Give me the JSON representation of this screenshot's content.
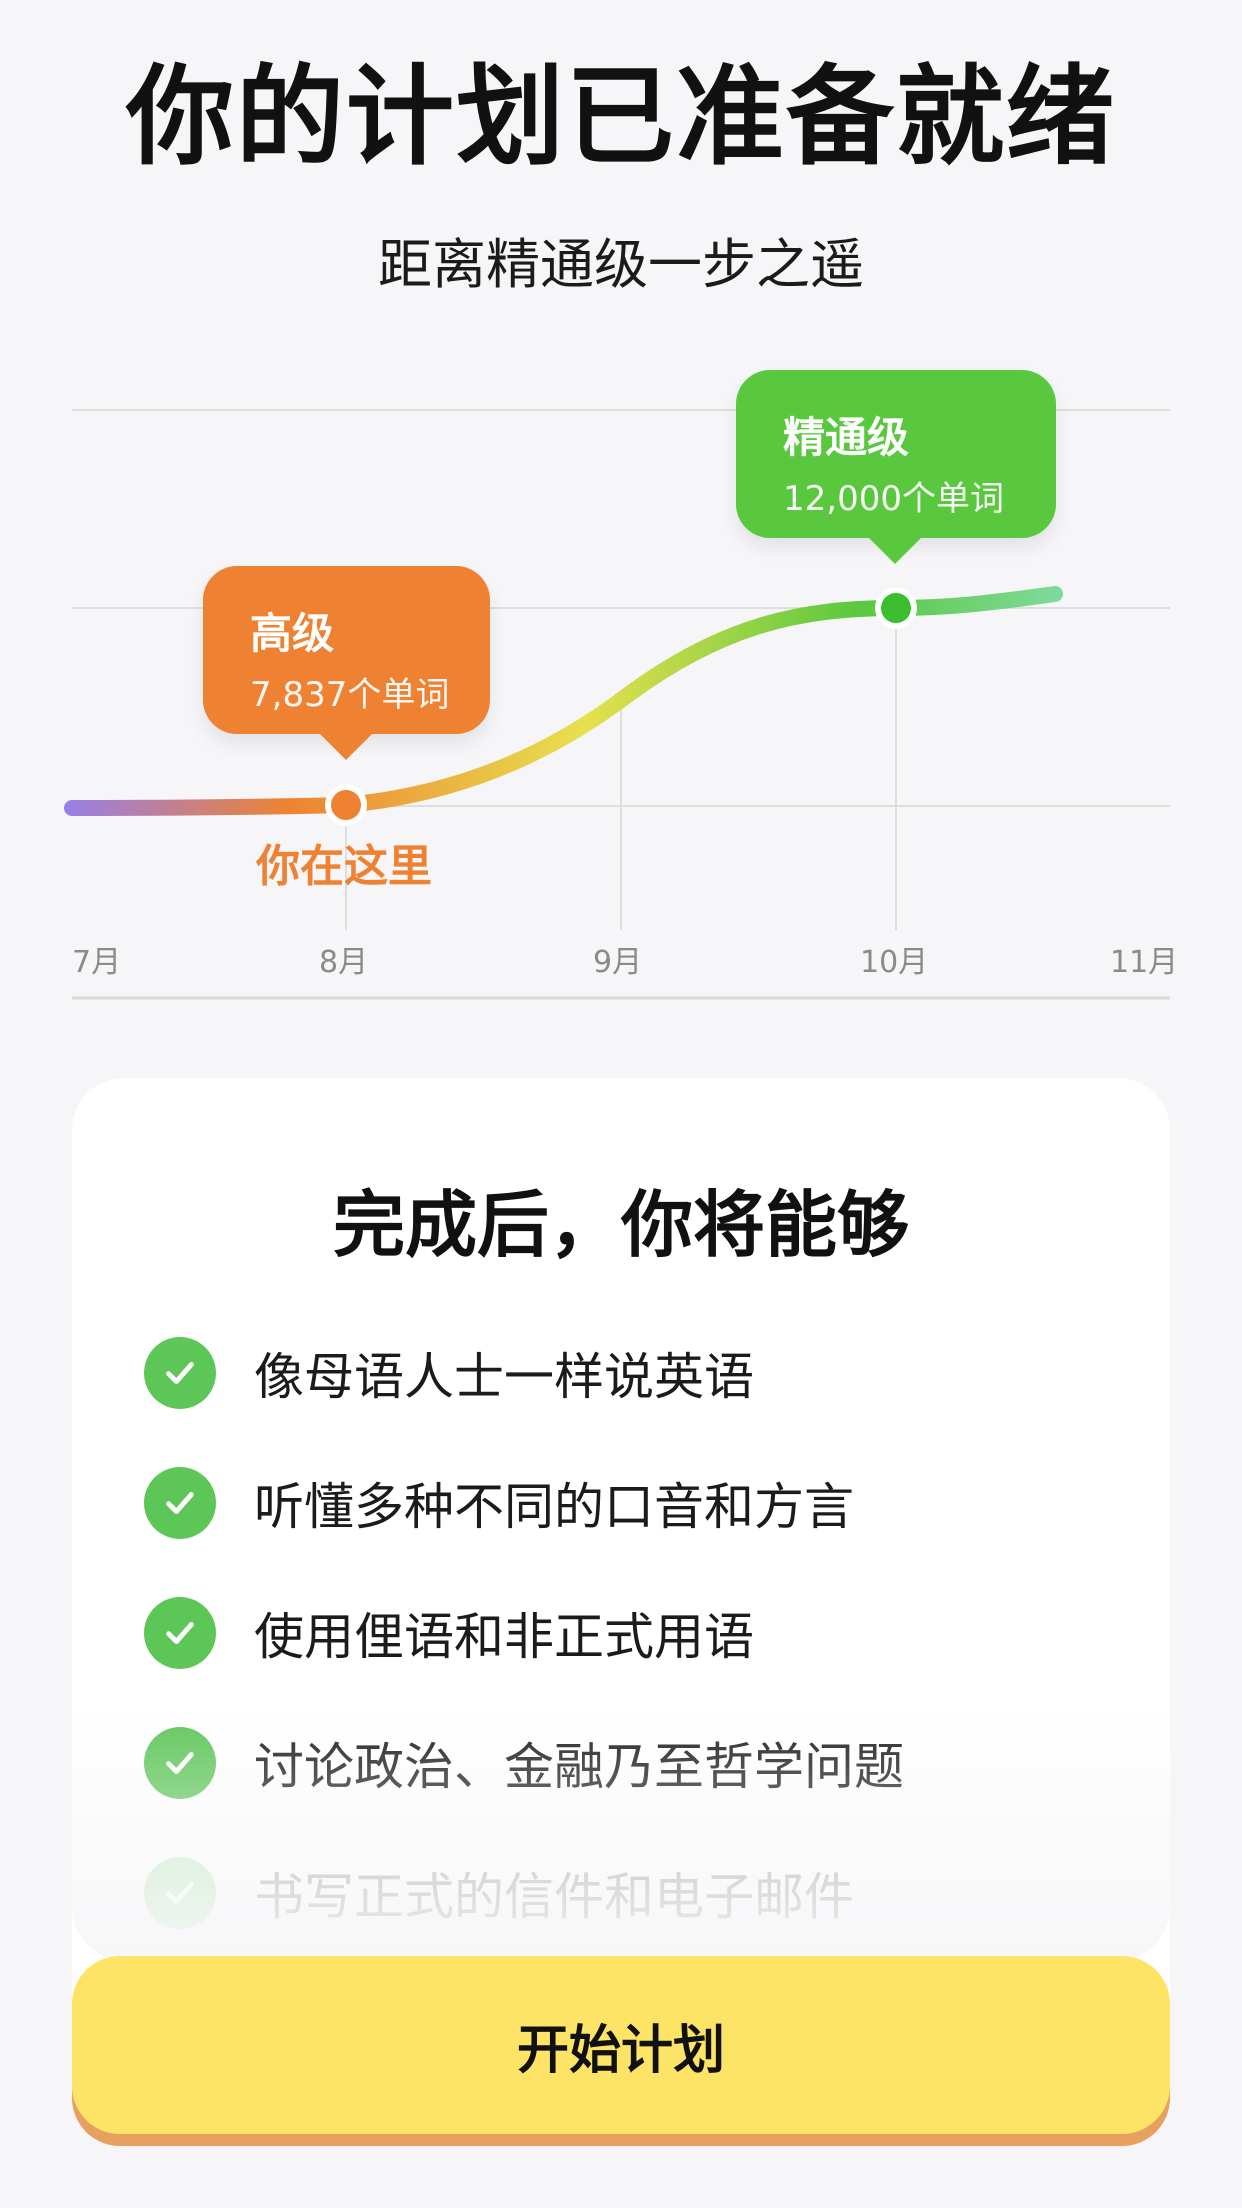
{
  "header": {
    "title": "你的计划已准备就绪",
    "subtitle": "距离精通级一步之遥"
  },
  "chart_data": {
    "type": "line",
    "x": [
      "7月",
      "8月",
      "9月",
      "10月",
      "11月"
    ],
    "series": [
      {
        "values": [
          1,
          1.1,
          2,
          3,
          3.1
        ]
      }
    ],
    "annotations": [
      {
        "title": "高级",
        "subtitle": "7,837个单词",
        "x": "8月",
        "color": "#ee8232"
      },
      {
        "title": "精通级",
        "subtitle": "12,000个单词",
        "x": "10月",
        "color": "#5ac83f"
      }
    ],
    "marker_label": "你在这里",
    "gradient_colors": [
      "#9b7fe2",
      "#ee8232",
      "#e7e04e",
      "#5ac83f",
      "#7fd99a"
    ]
  },
  "card": {
    "title": "完成后，你将能够",
    "benefits": [
      "像母语人士一样说英语",
      "听懂多种不同的口音和方言",
      "使用俚语和非正式用语",
      "讨论政治、金融乃至哲学问题",
      "书写正式的信件和电子邮件"
    ]
  },
  "cta": {
    "label": "开始计划"
  },
  "colors": {
    "accent_orange": "#ee8232",
    "accent_green": "#5ac83f",
    "button_yellow": "#fde466"
  }
}
